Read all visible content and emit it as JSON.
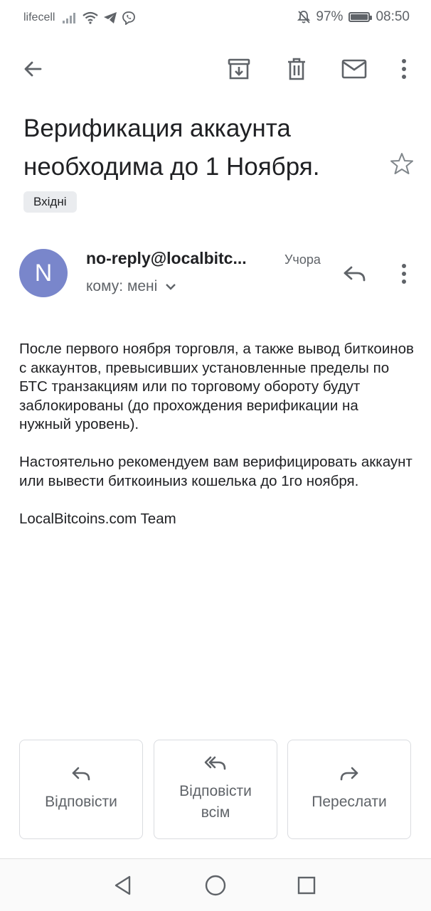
{
  "status_bar": {
    "carrier": "lifecell",
    "battery_percent": "97%",
    "battery_level": 0.97,
    "time": "08:50",
    "icons": [
      "signal-icon",
      "wifi-icon",
      "telegram-icon",
      "viber-icon",
      "mute-bell-icon",
      "battery-icon"
    ]
  },
  "toolbar": {
    "icons": [
      "back-arrow-icon",
      "archive-icon",
      "delete-icon",
      "mark-unread-icon",
      "more-vert-icon"
    ]
  },
  "email": {
    "subject": "Верификация аккаунта необходима до 1 Ноября.",
    "label": "Вхідні",
    "sender_initial": "N",
    "sender": "no-reply@localbitc...",
    "date": "Учора",
    "recipient": "кому: мені",
    "body": {
      "paragraph1": "После первого ноября торговля, а также вывод биткоинов с аккаунтов, превысивших установленные пределы по БТС транзакциям или по торговому обороту будут заблокированы (до прохождения верификации на нужный уровень).",
      "paragraph2": "Настоятельно рекомендуем вам верифицировать аккаунт или вывести биткоиныиз кошелька до 1го ноября.",
      "signature": "LocalBitcoins.com Team"
    }
  },
  "actions": {
    "reply": "Відповісти",
    "reply_all_line1": "Відповісти",
    "reply_all_line2": "всім",
    "forward": "Переслати"
  },
  "colors": {
    "avatar": "#7986cb",
    "icon": "#5f6368",
    "text": "#202124",
    "chip": "#eaecef"
  }
}
